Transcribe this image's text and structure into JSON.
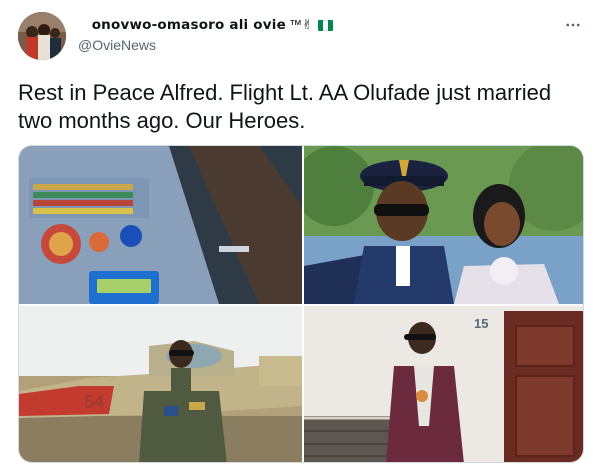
{
  "author": {
    "display_name": " onovwo-omasoro ali ovie",
    "name_suffix": "™✌",
    "handle": "@OvieNews",
    "flag_colors": [
      "#008751",
      "#ffffff",
      "#008751"
    ]
  },
  "more_icon": "more-horizontal-icon",
  "tweet": {
    "text": "Rest in Peace Alfred.  Flight Lt. AA Olufade just married two months ago. Our Heroes."
  },
  "media": {
    "photos": [
      {
        "id": "photo-1",
        "subject": "uniform-medals"
      },
      {
        "id": "photo-2",
        "subject": "wedding-couple"
      },
      {
        "id": "photo-3",
        "subject": "pilot-jet"
      },
      {
        "id": "photo-4",
        "subject": "man-in-suit"
      }
    ],
    "aircraft_number": "54",
    "door_number": "15"
  },
  "colors": {
    "text": "#0f1419",
    "secondary": "#536471",
    "border": "#cfd9de"
  }
}
